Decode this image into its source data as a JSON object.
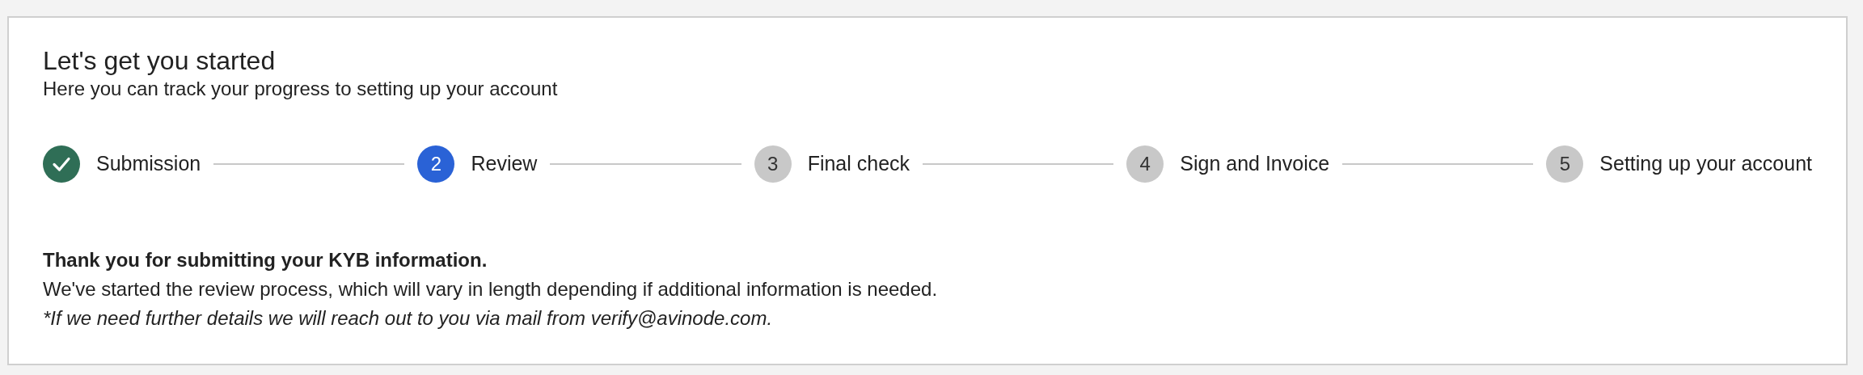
{
  "header": {
    "title": "Let's get you started",
    "subtitle": "Here you can track your progress to setting up your account"
  },
  "steps": [
    {
      "label": "Submission",
      "completed": true,
      "selected": false
    },
    {
      "number": "2",
      "label": "Review",
      "completed": false,
      "selected": true
    },
    {
      "number": "3",
      "label": "Final check",
      "completed": false,
      "selected": false
    },
    {
      "number": "4",
      "label": "Sign and Invoice",
      "completed": false,
      "selected": false
    },
    {
      "number": "5",
      "label": "Setting up your account",
      "completed": false,
      "selected": false
    }
  ],
  "message": {
    "heading": "Thank you for submitting your KYB information.",
    "body": "We've started the review process, which will vary in length depending if additional information is needed.",
    "note": "*If we need further details we will reach out to you via mail from verify@avinode.com."
  }
}
